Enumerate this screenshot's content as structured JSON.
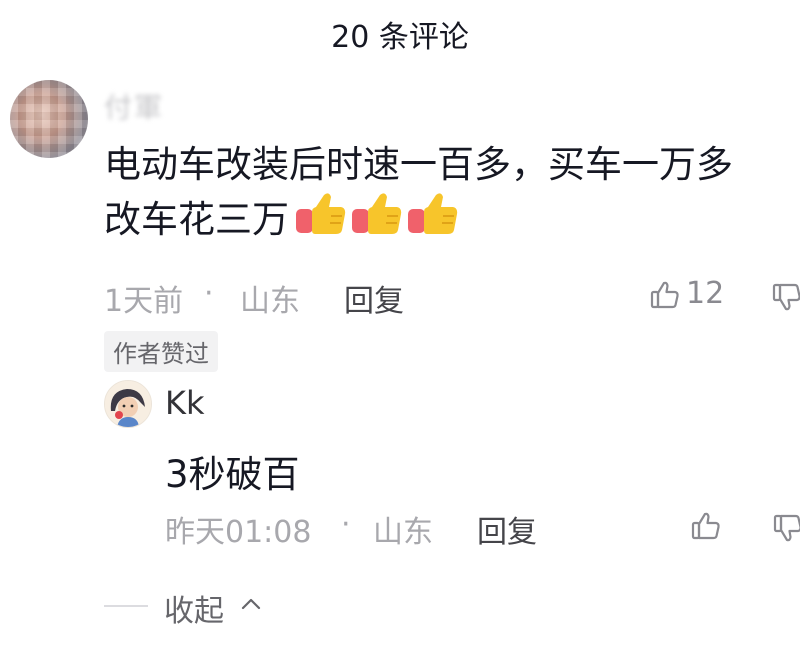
{
  "header": {
    "title": "20 条评论"
  },
  "comment": {
    "username": "付軍",
    "text_line1": "电动车改装后时速一百多，买车一万多",
    "text_line2": "改车花三万",
    "emojis": [
      "thumbs-up",
      "thumbs-up",
      "thumbs-up"
    ],
    "time": "1天前",
    "separator": "·",
    "location": "山东",
    "reply_label": "回复",
    "like_count": "12",
    "author_liked": "作者赞过"
  },
  "reply": {
    "username": "Kk",
    "text": "3秒破百",
    "time": "昨天01:08",
    "separator": "·",
    "location": "山东",
    "reply_label": "回复"
  },
  "collapse": {
    "label": "收起"
  },
  "colors": {
    "text_primary": "#161823",
    "text_secondary": "#a8a8ad",
    "tag_bg": "#f2f2f3",
    "thumb_yellow": "#f7c52b",
    "thumb_cuff": "#f0616b"
  }
}
